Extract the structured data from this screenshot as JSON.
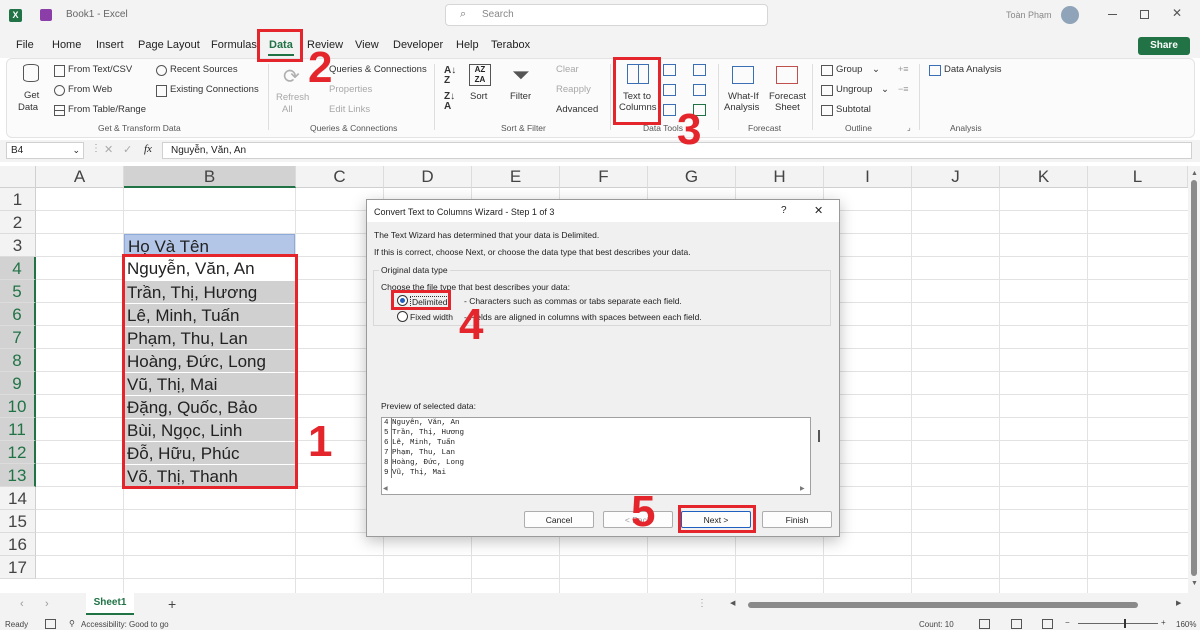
{
  "window": {
    "app_icon": "excel-icon",
    "title": "Book1 - Excel",
    "search_placeholder": "Search",
    "user_name": "Toàn Phạm"
  },
  "menu": {
    "tabs": [
      "File",
      "Home",
      "Insert",
      "Page Layout",
      "Formulas",
      "Data",
      "Review",
      "View",
      "Developer",
      "Help",
      "Terabox"
    ],
    "active_tab": "Data",
    "share_label": "Share"
  },
  "ribbon": {
    "get_data_line1": "Get",
    "get_data_line2": "Data",
    "from_text_csv": "From Text/CSV",
    "from_web": "From Web",
    "from_table_range": "From Table/Range",
    "recent_sources": "Recent Sources",
    "existing_connections": "Existing Connections",
    "group_get_transform": "Get & Transform Data",
    "refresh_line1": "Refresh",
    "refresh_line2": "All",
    "queries_connections": "Queries & Connections",
    "properties": "Properties",
    "edit_links": "Edit Links",
    "group_queries": "Queries & Connections",
    "sort": "Sort",
    "filter": "Filter",
    "clear": "Clear",
    "reapply": "Reapply",
    "advanced": "Advanced",
    "group_sort_filter": "Sort & Filter",
    "text_to_line1": "Text to",
    "text_to_line2": "Columns",
    "group_data_tools": "Data Tools",
    "whatif_line1": "What-If",
    "whatif_line2": "Analysis",
    "forecast_line1": "Forecast",
    "forecast_line2": "Sheet",
    "group_forecast": "Forecast",
    "group_btn": "Group",
    "ungroup_btn": "Ungroup",
    "subtotal": "Subtotal",
    "group_outline": "Outline",
    "data_analysis": "Data Analysis",
    "group_analysis": "Analysis"
  },
  "formula_bar": {
    "name_box": "B4",
    "fx": "fx",
    "value": "Nguyễn, Văn, An"
  },
  "grid": {
    "columns": [
      "A",
      "B",
      "C",
      "D",
      "E",
      "F",
      "G",
      "H",
      "I",
      "J",
      "K",
      "L"
    ],
    "rows": [
      "1",
      "2",
      "3",
      "4",
      "5",
      "6",
      "7",
      "8",
      "9",
      "10",
      "11",
      "12",
      "13",
      "14",
      "15",
      "16",
      "17"
    ],
    "header_cell": "Họ Và Tên",
    "names": [
      "Nguyễn, Văn, An",
      "Trần, Thị, Hương",
      "Lê, Minh, Tuấn",
      "Phạm, Thu, Lan",
      "Hoàng, Đức, Long",
      "Vũ, Thị, Mai",
      "Đặng, Quốc, Bảo",
      "Bùi, Ngọc, Linh",
      "Đỗ, Hữu, Phúc",
      "Võ, Thị, Thanh"
    ]
  },
  "dialog": {
    "title": "Convert Text to Columns Wizard - Step 1 of 3",
    "help": "?",
    "close": "✕",
    "line1": "The Text Wizard has determined that your data is Delimited.",
    "line2": "If this is correct, choose Next, or choose the data type that best describes your data.",
    "group_title": "Original data type",
    "choose_label": "Choose the file type that best describes your data:",
    "delimited_label": "Delimited",
    "delimited_desc": "- Characters such as commas or tabs separate each field.",
    "fixed_label": "Fixed width",
    "fixed_desc": "- Fields are aligned in columns with spaces between each field.",
    "preview_label": "Preview of selected data:",
    "preview_rows": [
      {
        "n": "4",
        "t": "Nguyễn, Văn, An"
      },
      {
        "n": "5",
        "t": "Trần, Thị, Hương"
      },
      {
        "n": "6",
        "t": "Lê, Minh, Tuấn"
      },
      {
        "n": "7",
        "t": "Phạm, Thu, Lan"
      },
      {
        "n": "8",
        "t": "Hoàng, Đức, Long"
      },
      {
        "n": "9",
        "t": "Vũ, Thị, Mai"
      }
    ],
    "cancel": "Cancel",
    "back": "< Back",
    "next": "Next >",
    "finish": "Finish"
  },
  "annotations": {
    "step1": "1",
    "step2": "2",
    "step3": "3",
    "step4": "4",
    "step5": "5",
    "color": "#e4262c"
  },
  "sheet_tabs": {
    "active": "Sheet1",
    "add": "+"
  },
  "status": {
    "ready": "Ready",
    "accessibility": "Accessibility: Good to go",
    "count": "Count: 10",
    "zoom": "160%"
  },
  "colors": {
    "excel_green": "#217346",
    "header_fill": "#b4c6e7",
    "selection_fill": "#d0d0d0"
  }
}
